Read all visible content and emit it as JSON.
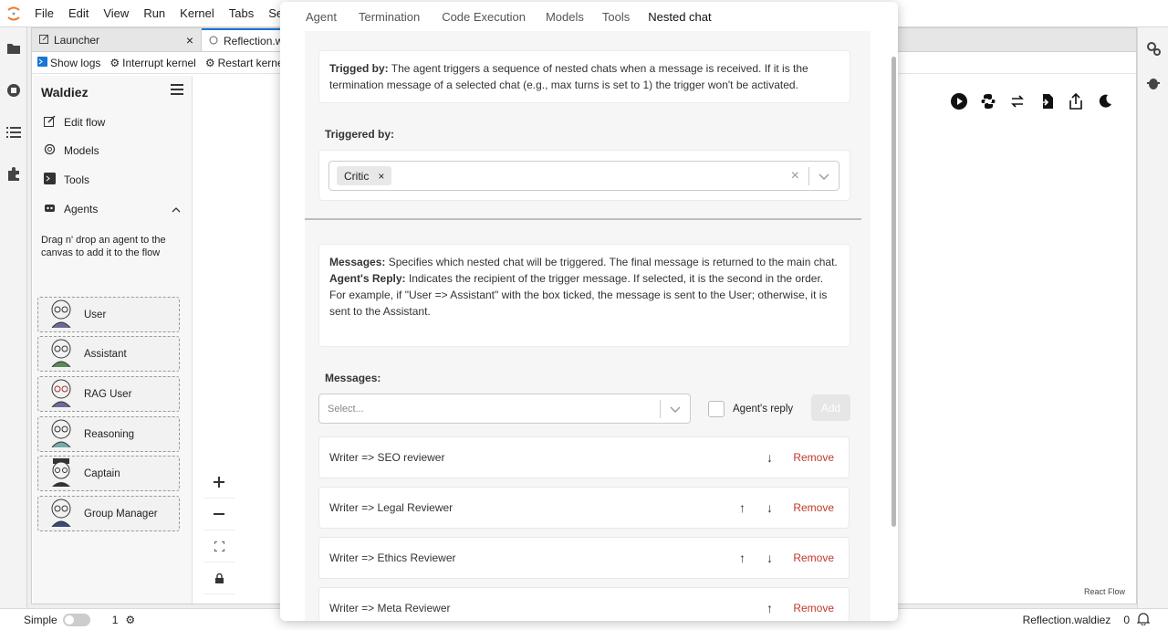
{
  "menubar": {
    "items": [
      "File",
      "Edit",
      "View",
      "Run",
      "Kernel",
      "Tabs",
      "Settin"
    ]
  },
  "tabs": {
    "launcher": "Launcher",
    "reflection": "Reflection.w"
  },
  "toolbar": {
    "show_logs": "Show logs",
    "interrupt": "Interrupt kernel",
    "restart": "Restart kerne"
  },
  "sidebar": {
    "title": "Waldiez",
    "nav": {
      "edit_flow": "Edit flow",
      "models": "Models",
      "tools": "Tools",
      "agents": "Agents"
    },
    "hint": "Drag n' drop an agent to the canvas to add it to the flow",
    "agents": [
      "User",
      "Assistant",
      "RAG User",
      "Reasoning",
      "Captain",
      "Group Manager"
    ]
  },
  "canvas": {
    "react_flow_label": "React Flow"
  },
  "statusbar": {
    "mode": "Simple",
    "kernel_count": "1",
    "filename": "Reflection.waldiez",
    "count": "0"
  },
  "modal": {
    "tabs": [
      "Agent",
      "Termination",
      "Code Execution",
      "Models",
      "Tools",
      "Nested chat"
    ],
    "trigger_info": {
      "label": "Trigged by:",
      "text": " The agent triggers a sequence of nested chats when a message is received. If it is the termination message of a selected chat (e.g., max turns is set to 1) the trigger won't be activated."
    },
    "triggered_by_label": "Triggered by:",
    "triggered_by_chip": "Critic",
    "messages_info": {
      "label": "Messages:",
      "text": " Specifies which nested chat will be triggered. The final message is returned to the main chat.",
      "reply_label": "Agent's Reply:",
      "reply_text": " Indicates the recipient of the trigger message. If selected, it is the second in the order. For example, if \"User => Assistant\" with the box ticked, the message is sent to the User; otherwise, it is sent to the Assistant."
    },
    "messages_label": "Messages:",
    "select_placeholder": "Select...",
    "agents_reply_label": "Agent's reply",
    "add_label": "Add",
    "remove_label": "Remove",
    "messages": [
      {
        "text": "Writer => SEO reviewer",
        "up": false,
        "down": true
      },
      {
        "text": "Writer => Legal Reviewer",
        "up": true,
        "down": true
      },
      {
        "text": "Writer => Ethics Reviewer",
        "up": true,
        "down": true
      },
      {
        "text": "Writer => Meta Reviewer",
        "up": true,
        "down": false
      }
    ]
  }
}
